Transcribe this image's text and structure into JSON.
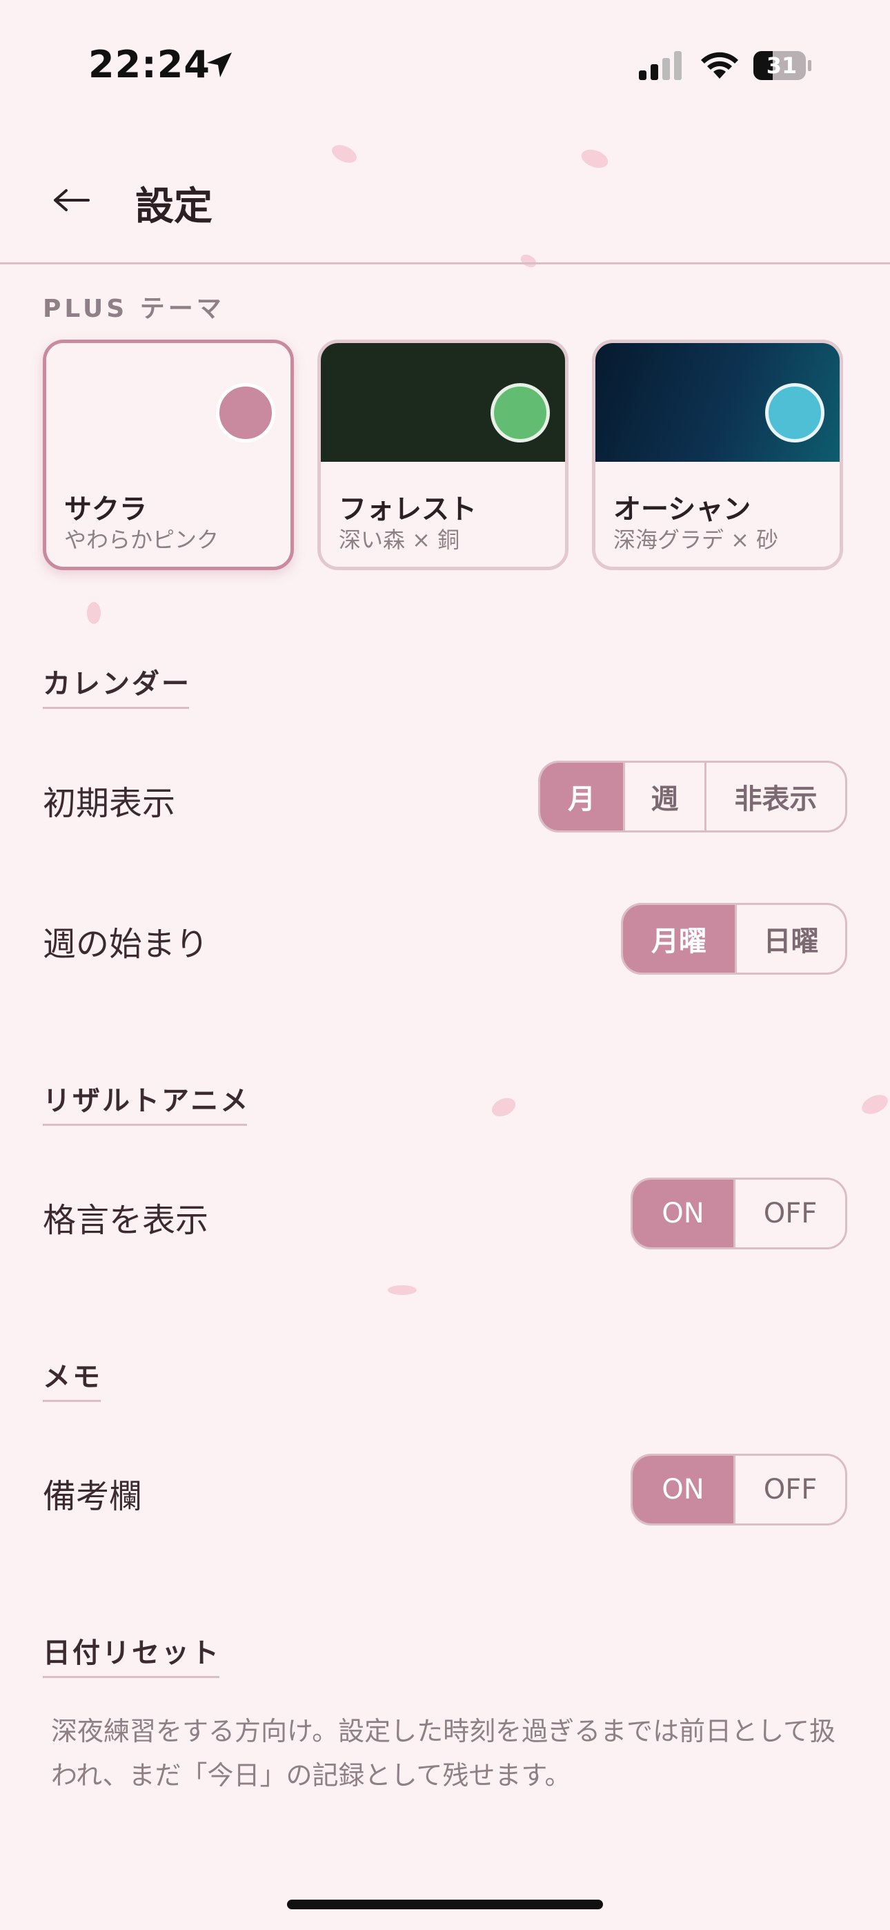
{
  "status_bar": {
    "time": "22:24",
    "battery": "31"
  },
  "header": {
    "title": "設定"
  },
  "plus_theme": {
    "label": "PLUS テーマ",
    "cards": [
      {
        "name": "サクラ",
        "sub": "やわらかピンク",
        "top_color": "#fcf2f3",
        "swatch_color": "#c9899f",
        "selected": true
      },
      {
        "name": "フォレスト",
        "sub": "深い森 × 銅",
        "top_color": "#1c2a1e",
        "swatch_color": "#62bd72",
        "selected": false
      },
      {
        "name": "オーシャン",
        "sub": "深海グラデ × 砂",
        "top_color": "#0b2a46",
        "swatch_color": "#4fbfd6",
        "selected": false
      }
    ]
  },
  "calendar": {
    "label": "カレンダー",
    "initial_view": {
      "label": "初期表示",
      "options": [
        "月",
        "週",
        "非表示"
      ],
      "selected": "月"
    },
    "week_start": {
      "label": "週の始まり",
      "options": [
        "月曜",
        "日曜"
      ],
      "selected": "月曜"
    }
  },
  "result_anime": {
    "label": "リザルトアニメ",
    "show_quote": {
      "label": "格言を表示",
      "options": [
        "ON",
        "OFF"
      ],
      "selected": "ON"
    }
  },
  "memo": {
    "label": "メモ",
    "notes_field": {
      "label": "備考欄",
      "options": [
        "ON",
        "OFF"
      ],
      "selected": "ON"
    }
  },
  "date_reset": {
    "label": "日付リセット",
    "description": "深夜練習をする方向け。設定した時刻を過ぎるまでは前日として扱われ、まだ「今日」の記録として残せます。"
  },
  "colors": {
    "accent": "#c9899f",
    "background": "#fcf2f3",
    "border": "#dcbcc5"
  }
}
